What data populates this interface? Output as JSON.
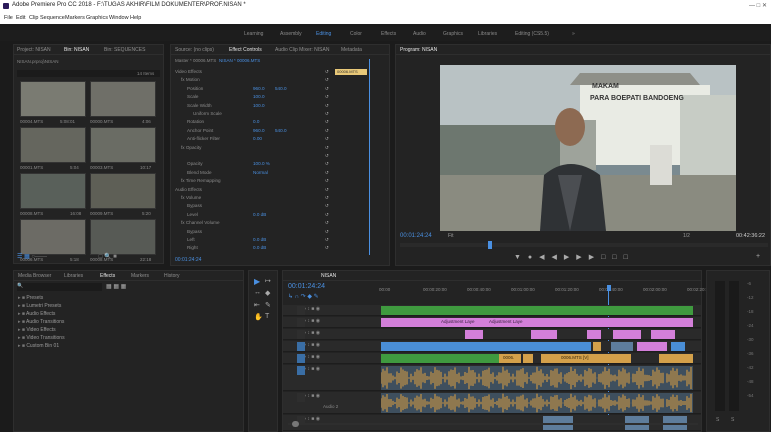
{
  "titlebar": {
    "title": "Adobe Premiere Pro CC 2018 - F:\\TUGAS AKHIR\\FILM DOKUMENTER\\PROF.NISAN *",
    "menu": [
      "File",
      "Edit",
      "Clip",
      "Sequence",
      "Markers",
      "Graphics",
      "Window",
      "Help"
    ]
  },
  "workspaces": [
    "Learning",
    "Assembly",
    "Editing",
    "Color",
    "Effects",
    "Audio",
    "Graphics",
    "Libraries",
    "Editing (CS5.5)",
    "»"
  ],
  "workspace_active": "Editing",
  "project": {
    "tabs": [
      "Project: NISAN",
      "Bin: NISAN",
      "Bin: SEQUENCES"
    ],
    "path": "NISAN.prproj\\NISAN",
    "items_count": "14 Items",
    "thumbs": [
      {
        "name": "00004.MTS",
        "dur": "5:08:01"
      },
      {
        "name": "00000.MTS",
        "dur": "4:06"
      },
      {
        "name": "00001.MTS",
        "dur": "5:04"
      },
      {
        "name": "00003.MTS",
        "dur": "10:17"
      },
      {
        "name": "00008.MTS",
        "dur": "16:08"
      },
      {
        "name": "00009.MTS",
        "dur": "5:20"
      },
      {
        "name": "00006.MTS",
        "dur": "5:18"
      },
      {
        "name": "00008.MTS",
        "dur": "22:18"
      }
    ]
  },
  "effect_controls": {
    "tabs": [
      "Source: (no clips)",
      "Effect Controls",
      "Audio Clip Mixer: NISAN",
      "Metadata"
    ],
    "master": "Master * 00006.MTS",
    "seq": "NISAN * 00006.MTS",
    "clip_label": "00006.MTS",
    "rows": [
      {
        "indent": 0,
        "label": "Video Effects",
        "v1": "",
        "v2": ""
      },
      {
        "indent": 1,
        "label": "fx  Motion",
        "v1": "",
        "v2": ""
      },
      {
        "indent": 2,
        "label": "Position",
        "v1": "960.0",
        "v2": "540.0"
      },
      {
        "indent": 2,
        "label": "Scale",
        "v1": "100.0",
        "v2": ""
      },
      {
        "indent": 2,
        "label": "Scale Width",
        "v1": "100.0",
        "v2": ""
      },
      {
        "indent": 3,
        "label": "Uniform Scale",
        "v1": "",
        "v2": ""
      },
      {
        "indent": 2,
        "label": "Rotation",
        "v1": "0.0",
        "v2": ""
      },
      {
        "indent": 2,
        "label": "Anchor Point",
        "v1": "960.0",
        "v2": "540.0"
      },
      {
        "indent": 2,
        "label": "Anti-flicker Filter",
        "v1": "0.00",
        "v2": ""
      },
      {
        "indent": 1,
        "label": "fx  Opacity",
        "v1": "",
        "v2": ""
      },
      {
        "indent": 2,
        "label": "",
        "v1": "",
        "v2": ""
      },
      {
        "indent": 2,
        "label": "Opacity",
        "v1": "100.0 %",
        "v2": ""
      },
      {
        "indent": 2,
        "label": "Blend Mode",
        "v1": "Normal",
        "v2": ""
      },
      {
        "indent": 1,
        "label": "fx  Time Remapping",
        "v1": "",
        "v2": ""
      },
      {
        "indent": 0,
        "label": "Audio Effects",
        "v1": "",
        "v2": ""
      },
      {
        "indent": 1,
        "label": "fx  Volume",
        "v1": "",
        "v2": ""
      },
      {
        "indent": 2,
        "label": "Bypass",
        "v1": "",
        "v2": ""
      },
      {
        "indent": 2,
        "label": "Level",
        "v1": "0.0 dB",
        "v2": ""
      },
      {
        "indent": 1,
        "label": "fx  Channel Volume",
        "v1": "",
        "v2": ""
      },
      {
        "indent": 2,
        "label": "Bypass",
        "v1": "",
        "v2": ""
      },
      {
        "indent": 2,
        "label": "Left",
        "v1": "0.0 dB",
        "v2": ""
      },
      {
        "indent": 2,
        "label": "Right",
        "v1": "0.0 dB",
        "v2": ""
      }
    ],
    "timecode": "00:01:24:24"
  },
  "program": {
    "tab": "Program: NISAN",
    "timecode": "00:01:24:24",
    "fit": "Fit",
    "quality": "1/2",
    "duration": "00:42:36:22",
    "sign_line1": "MAKAM",
    "sign_line2": "PARA BOEPATI BANDOENG"
  },
  "effects_panel": {
    "tabs": [
      "Media Browser",
      "Libraries",
      "Effects",
      "Markers",
      "History"
    ],
    "search_placeholder": "",
    "items": [
      "Presets",
      "Lumetri Presets",
      "Audio Effects",
      "Audio Transitions",
      "Video Effects",
      "Video Transitions",
      "Custom Bin 01"
    ]
  },
  "timeline": {
    "tab": "NISAN",
    "timecode": "00:01:24:24",
    "ruler": [
      "00:00",
      "00:00:20:00",
      "00:00:40:00",
      "00:01:00:00",
      "00:01:20:00",
      "00:01:40:00",
      "00:02:00:00",
      "00:02:20:00"
    ],
    "tracks_v": [
      "V4",
      "V3",
      "V2",
      "V1"
    ],
    "tracks_a": [
      "A1",
      "A2",
      "A3"
    ],
    "audio2_label": "Audio 2",
    "adj_labels": [
      "Adjustment Laye",
      "Adjustment Laye"
    ],
    "clip_names": [
      "0006.",
      "0006.MTS [V]"
    ]
  },
  "meter": {
    "labels": [
      "-6",
      "-12",
      "-18",
      "-24",
      "-30",
      "-36",
      "-42",
      "-48",
      "-54"
    ],
    "bottom": [
      "S",
      "S"
    ]
  }
}
